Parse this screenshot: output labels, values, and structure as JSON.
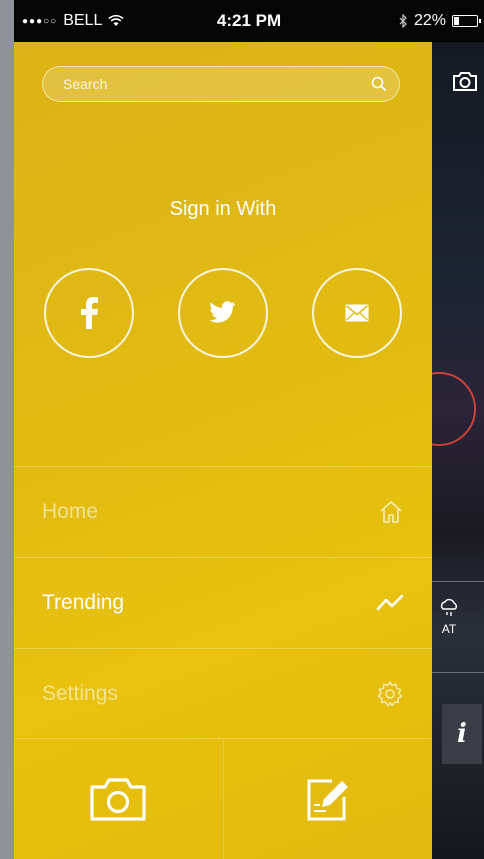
{
  "status_bar": {
    "signal_dots": "●●●○○",
    "carrier": "BELL",
    "wifi_icon": "wifi-icon",
    "time": "4:21 PM",
    "bluetooth_icon": "bluetooth-icon",
    "battery_percent": "22%",
    "battery_level": 0.22
  },
  "drawer": {
    "search": {
      "placeholder": "Search"
    },
    "signin_title": "Sign in With",
    "social_buttons": [
      {
        "name": "facebook",
        "icon": "facebook-icon"
      },
      {
        "name": "twitter",
        "icon": "twitter-icon"
      },
      {
        "name": "email",
        "icon": "mail-icon"
      }
    ],
    "menu": {
      "home_label": "Home",
      "trending_label": "Trending",
      "settings_label": "Settings"
    },
    "bottom_actions": [
      "camera-icon",
      "edit-icon"
    ]
  },
  "background_app": {
    "weather_text": "AT",
    "info_glyph": "i"
  },
  "colors": {
    "drawer_yellow": "#e2bb12",
    "status_bar": "#050505",
    "accent_red": "#c8423a"
  }
}
